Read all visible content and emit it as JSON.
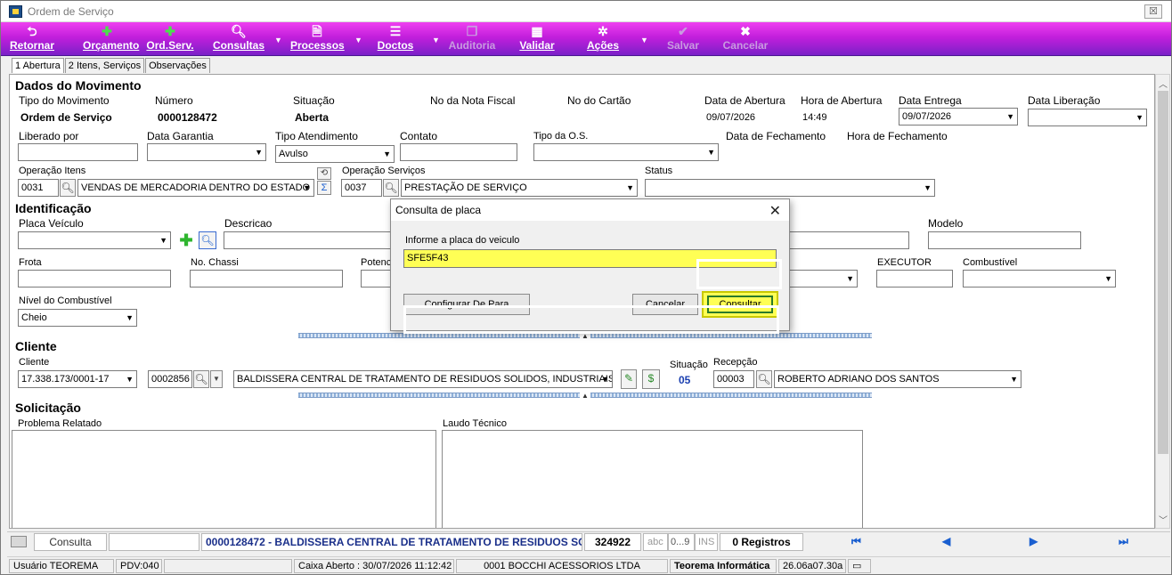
{
  "window": {
    "title": "Ordem de Serviço",
    "close_label": "☒"
  },
  "toolbar": {
    "retornar": "Retornar",
    "orcamento": "Orçamento",
    "ord_serv": "Ord.Serv.",
    "consultas": "Consultas",
    "processos": "Processos",
    "doctos": "Doctos",
    "auditoria": "Auditoria",
    "validar": "Validar",
    "acoes": "Ações",
    "salvar": "Salvar",
    "cancelar": "Cancelar"
  },
  "tabs": [
    "1 Abertura",
    "2 Itens, Serviços",
    "Observações"
  ],
  "movimento": {
    "section": "Dados do Movimento",
    "tipo_label": "Tipo do Movimento",
    "tipo_value": "Ordem de Serviço",
    "numero_label": "Número",
    "numero_value": "0000128472",
    "situacao_label": "Situação",
    "situacao_value": "Aberta",
    "nota_label": "No da Nota Fiscal",
    "cartao_label": "No do Cartão",
    "data_abertura_label": "Data de Abertura",
    "data_abertura_value": "09/07/2026",
    "hora_abertura_label": "Hora de Abertura",
    "hora_abertura_value": "14:49",
    "data_entrega_label": "Data Entrega",
    "data_entrega_value": "09/07/2026",
    "data_liberacao_label": "Data Liberação",
    "liberado_label": "Liberado por",
    "garantia_label": "Data Garantia",
    "tipo_atend_label": "Tipo Atendimento",
    "tipo_atend_value": "Avulso",
    "contato_label": "Contato",
    "tipo_os_label": "Tipo da O.S.",
    "data_fech_label": "Data de Fechamento",
    "hora_fech_label": "Hora de Fechamento",
    "op_itens_label": "Operação Itens",
    "op_itens_code": "0031",
    "op_itens_desc": "VENDAS DE MERCADORIA DENTRO DO ESTADO",
    "op_serv_label": "Operação Serviços",
    "op_serv_code": "0037",
    "op_serv_desc": "PRESTAÇÃO DE SERVIÇO",
    "status_label": "Status"
  },
  "identificacao": {
    "section": "Identificação",
    "placa_label": "Placa Veículo",
    "descricao_label": "Descricao",
    "modelo_label": "Modelo",
    "frota_label": "Frota",
    "chassi_label": "No. Chassi",
    "potencia_label": "Potenc",
    "executor_label": "EXECUTOR",
    "combustivel_label": "Combustível",
    "nivel_label": "Nível do Combustível",
    "nivel_value": "Cheio"
  },
  "cliente": {
    "section": "Cliente",
    "cliente_label": "Cliente",
    "cnpj": "17.338.173/0001-17",
    "codigo": "0002856",
    "nome": "BALDISSERA CENTRAL DE TRATAMENTO DE RESIDUOS SOLIDOS, INDUSTRIAIS E",
    "situacao_label": "Situação",
    "situacao_value": "05",
    "recepcao_label": "Recepção",
    "recepcao_code": "00003",
    "recepcao_nome": "ROBERTO ADRIANO DOS SANTOS"
  },
  "solicitacao": {
    "section": "Solicitação",
    "problema_label": "Problema Relatado",
    "laudo_label": "Laudo Técnico"
  },
  "recbar": {
    "consulta": "Consulta",
    "descricao": "0000128472 - BALDISSERA CENTRAL DE TRATAMENTO DE RESIDUOS SC",
    "numero": "324922",
    "abc": "abc",
    "num_range": "0...9",
    "ins": "INS",
    "registros": "0 Registros"
  },
  "statusbar": {
    "usuario": "Usuário TEOREMA",
    "pdv": "PDV:040",
    "caixa": "Caixa Aberto : 30/07/2026 11:12:42",
    "empresa": "0001 BOCCHI ACESSORIOS LTDA",
    "teorema": "Teorema Informática",
    "versao": "26.06a07.30a"
  },
  "modal": {
    "title": "Consulta de placa",
    "prompt": "Informe a placa do veiculo",
    "value": "SFE5F43",
    "configurar": "Configurar De Para",
    "cancelar": "Cancelar",
    "consultar": "Consultar"
  }
}
